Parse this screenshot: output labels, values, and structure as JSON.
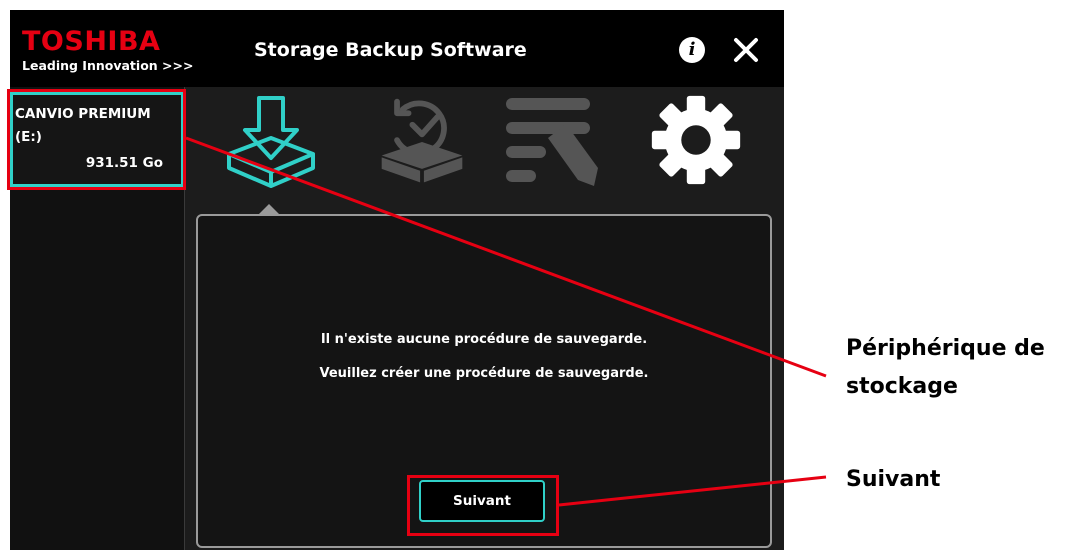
{
  "app": {
    "brand": "TOSHIBA",
    "tagline": "Leading Innovation >>>",
    "title": "Storage Backup Software"
  },
  "device": {
    "name": "CANVIO PREMIUM",
    "drive": "(E:)",
    "size": "931.51 Go"
  },
  "toolbar": {
    "icons": [
      "backup-icon",
      "restore-icon",
      "edit-settings-icon",
      "gear-icon"
    ],
    "active": "backup-icon"
  },
  "panel": {
    "message_1": "Il n'existe aucune procédure de sauvegarde.",
    "message_2": "Veuillez créer une procédure de sauvegarde.",
    "next_button": "Suivant"
  },
  "annotations": {
    "device_label_line1": "Périphérique de",
    "device_label_line2": "stockage",
    "next_label": "Suivant"
  },
  "colors": {
    "accent": "#30d0c8",
    "brand": "#e60012",
    "highlight": "#e60012",
    "background": "#1c1c1c"
  }
}
